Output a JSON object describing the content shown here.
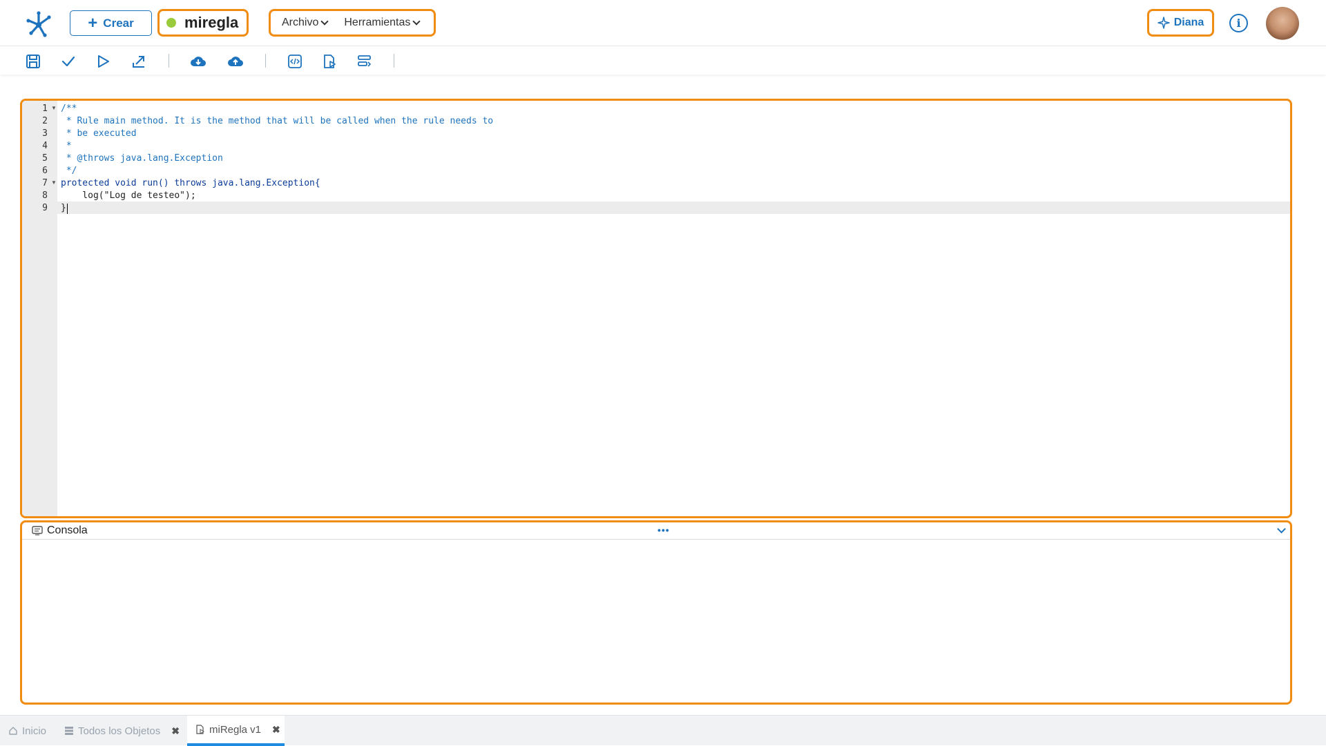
{
  "header": {
    "create_label": "Crear",
    "rule_name": "miregla",
    "menus": [
      "Archivo",
      "Herramientas"
    ],
    "assistant_label": "Diana",
    "info_symbol": "i"
  },
  "toolbar": {
    "icons": [
      "save-icon",
      "check-icon",
      "play-icon",
      "export-icon",
      "cloud-download-icon",
      "cloud-upload-icon",
      "code-view-icon",
      "rule-doc-icon",
      "format-icon"
    ]
  },
  "editor": {
    "line_numbers": [
      "1",
      "2",
      "3",
      "4",
      "5",
      "6",
      "7",
      "8",
      "9"
    ],
    "lines": [
      "/**",
      " * Rule main method. It is the method that will be called when the rule needs to",
      " * be executed",
      " *",
      " * @throws java.lang.Exception",
      " */",
      "protected void run() throws java.lang.Exception{",
      "    log(\"Log de testeo\");",
      "}"
    ]
  },
  "console": {
    "title": "Consola",
    "handle": "•••"
  },
  "tabs": [
    {
      "label": "Inicio",
      "closable": false
    },
    {
      "label": "Todos los Objetos",
      "closable": true
    },
    {
      "label": "miRegla v1",
      "closable": true
    }
  ],
  "colors": {
    "accent": "#1e73be",
    "highlight": "#f08c12",
    "status_dot": "#9acb3c",
    "active_tab": "#1e8be0"
  }
}
